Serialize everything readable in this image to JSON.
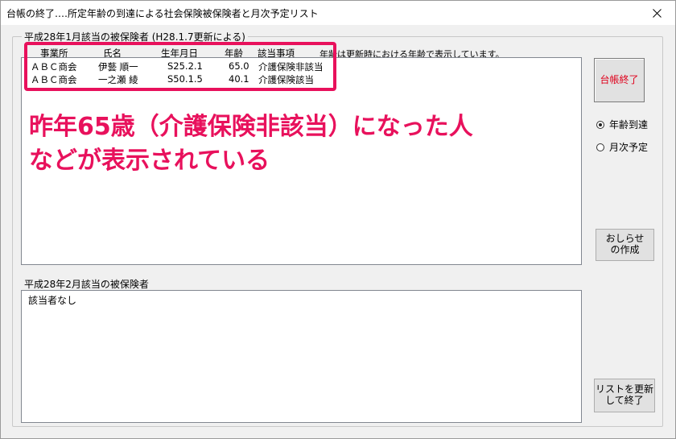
{
  "window": {
    "title": "台帳の終了‥‥所定年齢の到達による社会保険被保険者と月次予定リスト"
  },
  "group": {
    "label": "平成28年1月該当の被保険者 (H28.1.7更新による)"
  },
  "note": "年齢は更新時における年齢で表示しています。",
  "table1": {
    "headers": [
      "事業所",
      "氏名",
      "生年月日",
      "年齢",
      "該当事項"
    ],
    "rows": [
      [
        "ＡＢＣ商会",
        "伊藝 順一",
        "S25.2.1",
        "65.0",
        "介護保険非該当"
      ],
      [
        "ＡＢＣ商会",
        "一之瀬 綾",
        "S50.1.5",
        "40.1",
        "介護保険該当"
      ]
    ]
  },
  "section2": {
    "label": "平成28年2月該当の被保険者",
    "content": "該当者なし"
  },
  "buttons": {
    "close_ledger": "台帳終了",
    "notice": "おしらせ\nの作成",
    "update": "リストを更新\nして終了"
  },
  "radios": {
    "age_reached": "年齢到達",
    "monthly_plan": "月次予定",
    "selected": "age_reached"
  },
  "annotation": {
    "line1": "昨年65歳（介護保険非該当）になった人",
    "line2": "などが表示されている"
  },
  "colors": {
    "annotation": "#e8115c",
    "close_ledger_text": "#e0001b"
  }
}
